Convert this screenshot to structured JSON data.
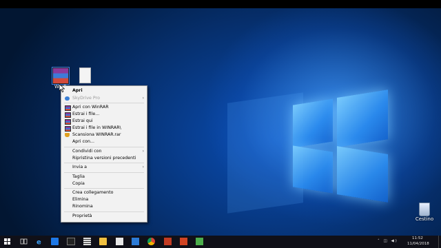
{
  "desktop": {
    "icons": [
      {
        "label": "WinR",
        "icon": "winrar-archive-icon"
      },
      {
        "label": "",
        "icon": "blank-file-icon"
      }
    ],
    "recycle_bin": {
      "label": "Cestino",
      "icon": "recycle-bin-icon"
    }
  },
  "context_menu": {
    "items": [
      {
        "label": "Apri",
        "bold": true
      },
      {
        "label": "SkyDrive Pro",
        "disabled": true,
        "submenu": true,
        "icon": "cloud-icon"
      },
      {
        "label": "Apri con WinRAR",
        "icon": "winrar-icon"
      },
      {
        "label": "Estrai i file...",
        "icon": "winrar-icon"
      },
      {
        "label": "Estrai qui",
        "icon": "winrar-icon"
      },
      {
        "label": "Estrai i file in WINRAR\\",
        "icon": "winrar-icon"
      },
      {
        "label": "Scansiona WINRAR.rar",
        "icon": "shield-icon"
      },
      {
        "label": "Apri con..."
      },
      {
        "label": "Condividi con",
        "submenu": true
      },
      {
        "label": "Ripristina versioni precedenti"
      },
      {
        "label": "Invia a",
        "submenu": true
      },
      {
        "label": "Taglia"
      },
      {
        "label": "Copia"
      },
      {
        "label": "Crea collegamento"
      },
      {
        "label": "Elimina"
      },
      {
        "label": "Rinomina"
      },
      {
        "label": "Proprietà"
      }
    ]
  },
  "taskbar": {
    "apps": [
      "start-icon",
      "search-icon",
      "task-view-icon",
      "edge-icon",
      "store-icon",
      "cmd-icon",
      "calculator-icon",
      "file-explorer-icon",
      "media-player-icon",
      "photos-icon",
      "chrome-icon",
      "mail-icon",
      "powerpoint-icon",
      "camtasia-icon",
      "app-icon"
    ],
    "clock": {
      "time": "11:52",
      "date": "11/04/2018"
    }
  },
  "colors": {
    "taskbar": "#101018",
    "menu_bg": "#f2f2f2",
    "accent": "#1e78e6"
  }
}
